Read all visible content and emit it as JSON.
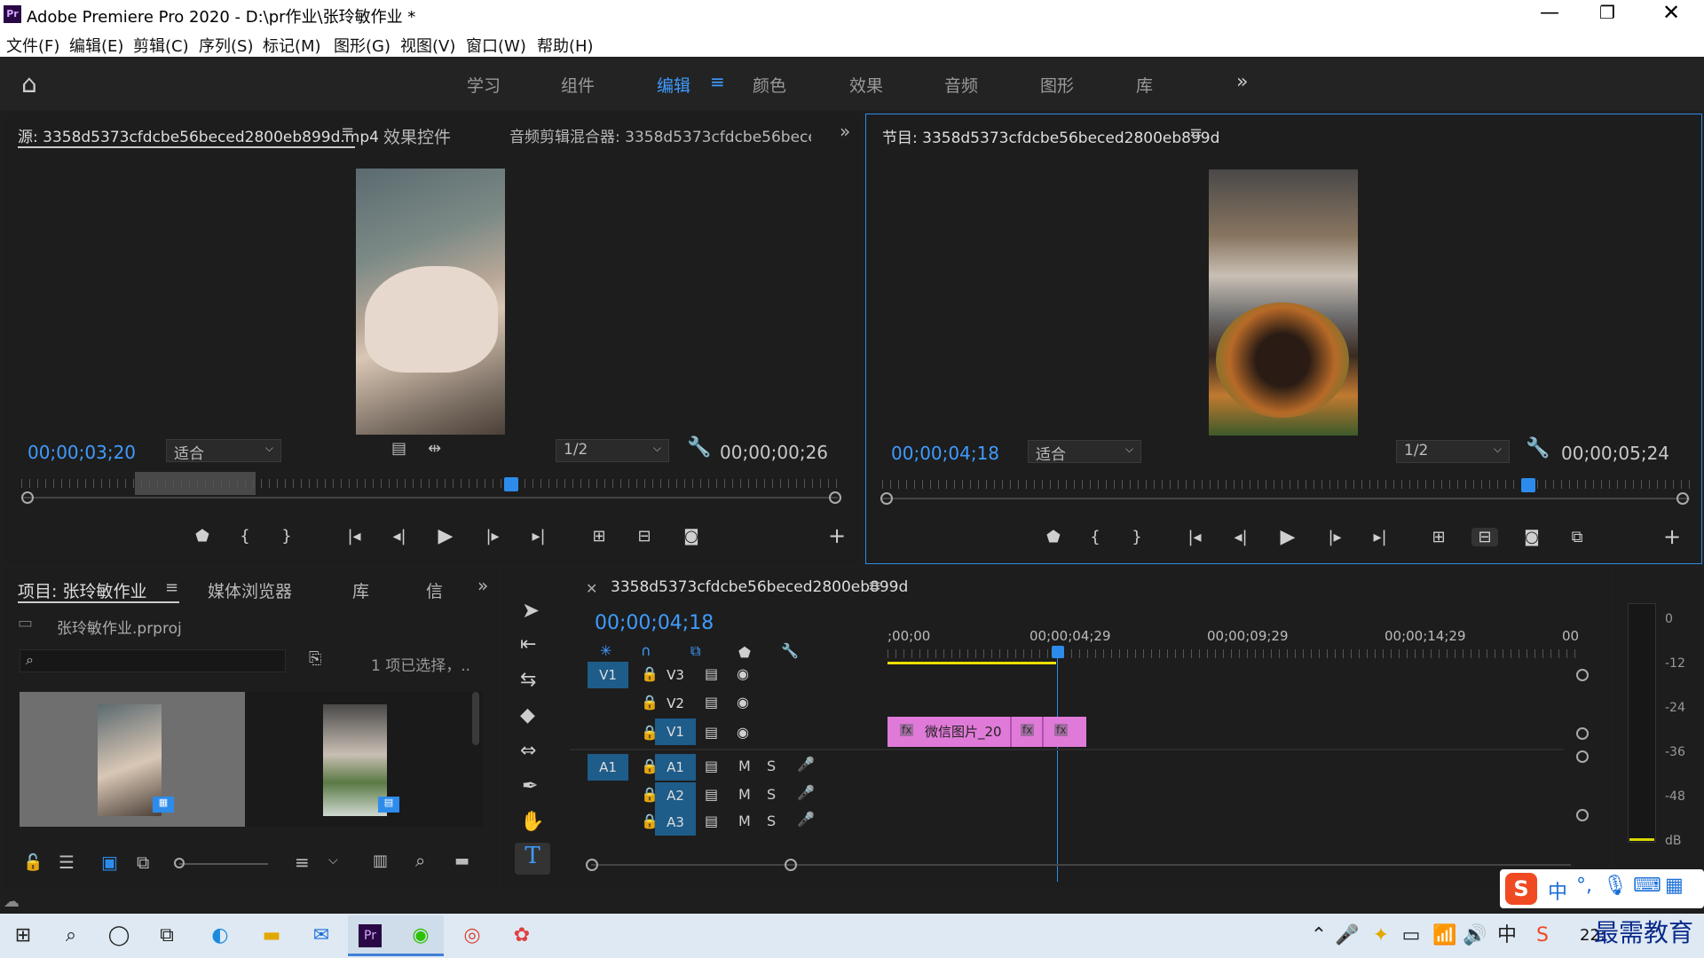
{
  "window": {
    "title": "Adobe Premiere Pro 2020 - D:\\pr作业\\张玲敏作业 *"
  },
  "menu": [
    "文件(F)",
    "编辑(E)",
    "剪辑(C)",
    "序列(S)",
    "标记(M)",
    "图形(G)",
    "视图(V)",
    "窗口(W)",
    "帮助(H)"
  ],
  "workspaces": [
    "学习",
    "组件",
    "编辑",
    "颜色",
    "效果",
    "音频",
    "图形",
    "库"
  ],
  "source": {
    "tab": "源: 3358d5373cfdcbe56beced2800eb899d.mp4",
    "tab2": "效果控件",
    "tab3": "音频剪辑混合器: 3358d5373cfdcbe56bece",
    "timecode": "00;00;03;20",
    "fit": "适合",
    "res": "1/2",
    "duration": "00;00;00;26",
    "playhead_fraction": 0.6
  },
  "program": {
    "tab": "节目: 3358d5373cfdcbe56beced2800eb899d",
    "timecode": "00;00;04;18",
    "fit": "适合",
    "res": "1/2",
    "duration": "00;00;05;24",
    "playhead_fraction": 0.8
  },
  "project": {
    "tab": "项目: 张玲敏作业",
    "tab2": "媒体浏览器",
    "tab3": "库",
    "tab4": "信",
    "file": "张玲敏作业.prproj",
    "selection": "1 项已选择，.."
  },
  "timeline": {
    "tab": "3358d5373cfdcbe56beced2800eb899d",
    "timecode": "00;00;04;18",
    "ruler": [
      ";00;00",
      "00;00;04;29",
      "00;00;09;29",
      "00;00;14;29",
      "00"
    ],
    "clip": "微信图片_20",
    "tracks": {
      "video": [
        "V3",
        "V2",
        "V1"
      ],
      "audio": [
        "A1",
        "A2",
        "A3"
      ]
    },
    "src_v": "V1",
    "src_a": "A1",
    "m": "M",
    "s": "S"
  },
  "meter": [
    "0",
    "-12",
    "-24",
    "-36",
    "-48",
    "dB"
  ],
  "ime": {
    "label": "中"
  },
  "watermark": "最需教育",
  "clock": "22:"
}
